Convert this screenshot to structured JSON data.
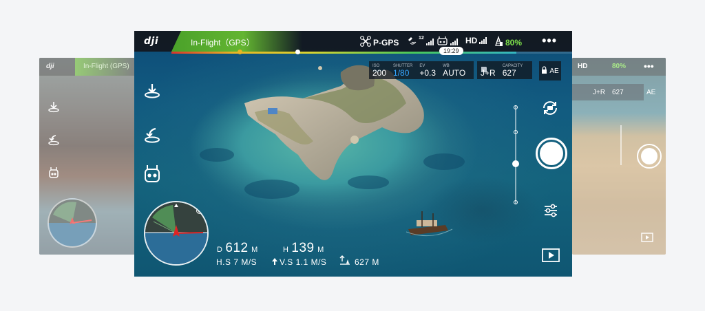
{
  "side_left": {
    "status": "In-Flight (GPS)"
  },
  "side_right": {
    "hd_label": "HD",
    "battery": "80%",
    "iso_hint": "J+R",
    "capacity_hint": "627",
    "ae_hint": "AE"
  },
  "app": {
    "logo": "dji",
    "flight_status": "In-Flight（GPS）",
    "gps_mode": "P-GPS",
    "satellites": "12",
    "hd_label": "HD",
    "battery": "80%",
    "menu": "•••",
    "time": "19:29",
    "progress_percent": 86
  },
  "camera_params": {
    "iso": {
      "label": "ISO",
      "value": "200"
    },
    "shutter": {
      "label": "SHUTTER",
      "value": "1/80"
    },
    "ev": {
      "label": "EV",
      "value": "+0.3"
    },
    "wb": {
      "label": "WB",
      "value": "AUTO"
    },
    "format": {
      "label": "",
      "value": "J+R"
    },
    "capacity": {
      "label": "CAPACITY",
      "value": "627"
    },
    "ae": "AE"
  },
  "telemetry": {
    "d_label": "D",
    "d_value": "612",
    "d_unit": "M",
    "h_label": "H",
    "h_value": "139",
    "h_unit": "M",
    "hs": "H.S 7 M/S",
    "vs": "V.S 1.1 M/S",
    "dist_home": "627 M"
  },
  "icons": {
    "takeoff": "takeoff-icon",
    "return_home": "return-home-icon",
    "remote": "remote-controller-icon",
    "camera_switch": "camera-switch-icon",
    "settings": "settings-sliders-icon",
    "playback": "playback-icon"
  }
}
